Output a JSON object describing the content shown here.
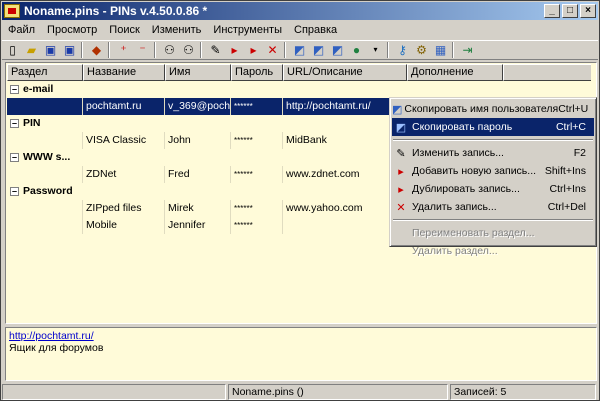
{
  "window": {
    "title": "Noname.pins - PINs v.4.50.0.86 *"
  },
  "menu": [
    "Файл",
    "Просмотр",
    "Поиск",
    "Изменить",
    "Инструменты",
    "Справка"
  ],
  "toolbar_icons": [
    "new-icon",
    "open-icon",
    "save-icon",
    "save-as-icon",
    "export-icon",
    "add-section-icon",
    "remove-section-icon",
    "find-icon",
    "find-next-icon",
    "edit-icon",
    "add-record-icon",
    "duplicate-icon",
    "delete-icon",
    "copy-user-icon",
    "copy-password-icon",
    "open-url-icon",
    "web-icon",
    "dropdown-icon",
    "key-icon",
    "settings-icon",
    "tools-icon",
    "exit-icon"
  ],
  "columns": [
    "Раздел",
    "Название",
    "Имя",
    "Пароль",
    "URL/Описание",
    "Дополнение"
  ],
  "rows": [
    {
      "type": "section",
      "section": "e-mail"
    },
    {
      "type": "record",
      "name": "pochtamt.ru",
      "user": "v_369@poch...",
      "password": "******",
      "url": "http://pochtamt.ru/",
      "extra": "",
      "selected": true
    },
    {
      "type": "section",
      "section": "PIN"
    },
    {
      "type": "record",
      "name": "VISA Classic",
      "user": "John",
      "password": "******",
      "url": "MidBank",
      "extra": ""
    },
    {
      "type": "section",
      "section": "WWW s..."
    },
    {
      "type": "record",
      "name": "ZDNet",
      "user": "Fred",
      "password": "******",
      "url": "www.zdnet.com",
      "extra": ""
    },
    {
      "type": "section",
      "section": "Password"
    },
    {
      "type": "record",
      "name": "ZIPped files",
      "user": "Mirek",
      "password": "******",
      "url": "www.yahoo.com",
      "extra": ""
    },
    {
      "type": "record",
      "name": "Mobile",
      "user": "Jennifer",
      "password": "******",
      "url": "",
      "extra": ""
    }
  ],
  "notes": {
    "link": "http://pochtamt.ru/",
    "text": "Ящик для форумов"
  },
  "status": {
    "file": "Noname.pins ()",
    "records": "Записей: 5"
  },
  "context_menu": [
    {
      "label": "Скопировать имя пользователя",
      "shortcut": "Ctrl+U",
      "icon": "copy-user-icon"
    },
    {
      "label": "Скопировать пароль",
      "shortcut": "Ctrl+C",
      "icon": "copy-password-icon",
      "highlighted": true
    },
    {
      "separator": true
    },
    {
      "label": "Изменить запись...",
      "shortcut": "F2",
      "icon": "edit-icon"
    },
    {
      "label": "Добавить новую запись...",
      "shortcut": "Shift+Ins",
      "icon": "add-record-icon"
    },
    {
      "label": "Дублировать запись...",
      "shortcut": "Ctrl+Ins",
      "icon": "duplicate-icon"
    },
    {
      "label": "Удалить запись...",
      "shortcut": "Ctrl+Del",
      "icon": "delete-icon"
    },
    {
      "separator": true
    },
    {
      "label": "Переименовать раздел...",
      "shortcut": "",
      "disabled": true
    },
    {
      "label": "Удалить раздел...",
      "shortcut": "",
      "disabled": true
    }
  ]
}
